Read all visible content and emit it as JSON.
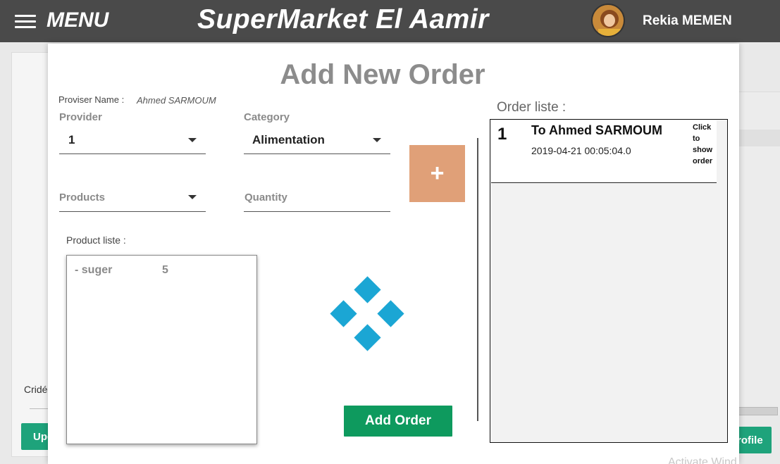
{
  "topbar": {
    "menu_label": "MENU",
    "app_title": "SuperMarket El Aamir",
    "user_name": "Rekia MEMEN"
  },
  "background": {
    "credit_label": "Cridé",
    "update_button": "Upd",
    "profile_button": "rofile",
    "watermark": "Activate Wind"
  },
  "modal": {
    "title": "Add New Order",
    "provider_name_label": "Proviser Name :",
    "provider_name_value": "Ahmed SARMOUM",
    "provider": {
      "label": "Provider",
      "value": "1"
    },
    "category": {
      "label": "Category",
      "value": "Alimentation"
    },
    "products": {
      "label": "Products"
    },
    "quantity": {
      "label": "Quantity"
    },
    "plus_button": "+",
    "product_list_label": "Product liste :",
    "product_list": [
      {
        "name": "- suger",
        "quantity": "5"
      }
    ],
    "add_order_button": "Add Order",
    "order_list_label": "Order liste :",
    "orders": [
      {
        "number": "1",
        "title": "To Ahmed SARMOUM",
        "date": "2019-04-21 00:05:04.0",
        "click_hint": "Click to show order"
      }
    ]
  },
  "colors": {
    "topbar": "#4a4a4a",
    "plus_button": "#e0a078",
    "add_order_button": "#0e9a5e",
    "spinner": "#1ba6d4",
    "background_button": "#1ea37b"
  },
  "icons": [
    "hamburger-icon",
    "dropdown-caret-icon",
    "loading-spinner-icon"
  ]
}
